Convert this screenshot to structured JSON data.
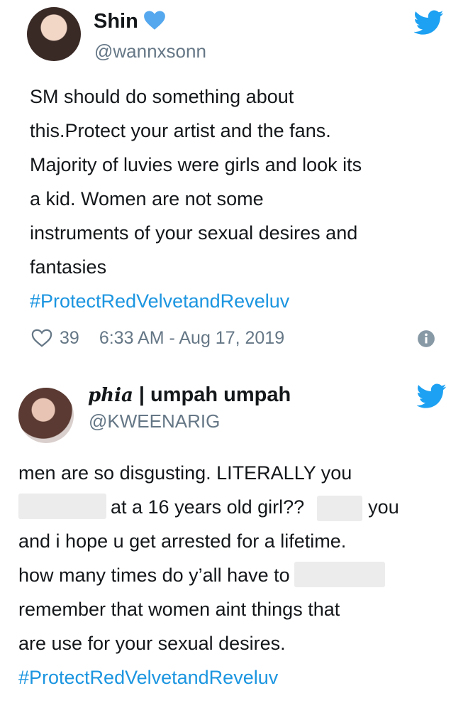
{
  "tweets": [
    {
      "display_name": "Shin",
      "handle": "@wannxsonn",
      "lines": [
        "SM should do something about",
        "this.Protect your artist and the fans.",
        "Majority of luvies were girls and look its",
        "a kid. Women are not some",
        "instruments of your sexual desires and",
        "fantasies"
      ],
      "hashtag": "#ProtectRedVelvetandReveluv",
      "likes": "39",
      "timestamp": "6:33 AM - Aug 17, 2019",
      "icons": {
        "avatar": "user-avatar",
        "verified": "verified-badge-icon",
        "bird": "twitter-bird-icon",
        "heart": "heart-icon",
        "info": "info-icon"
      }
    },
    {
      "display_name_italic": "phia",
      "display_name_rest": " | umpah umpah",
      "handle": "@KWEENARIG",
      "line1": "men are so disgusting. LITERALLY you",
      "line2_b": "at a 16 years old girl??",
      "line2_d": "you",
      "line3": "and i hope u get arrested for a lifetime.",
      "line4_a": "how many times do y’all have to",
      "line5": "remember that women aint things that",
      "line6": "are use for your sexual desires.",
      "hashtag": "#ProtectRedVelvetandReveluv",
      "icons": {
        "avatar": "user-avatar",
        "bird": "twitter-bird-icon"
      }
    }
  ],
  "colors": {
    "text": "#14171a",
    "muted": "#657786",
    "link": "#1b95e0",
    "verified": "#1da1f2",
    "redaction": "#ececec"
  }
}
